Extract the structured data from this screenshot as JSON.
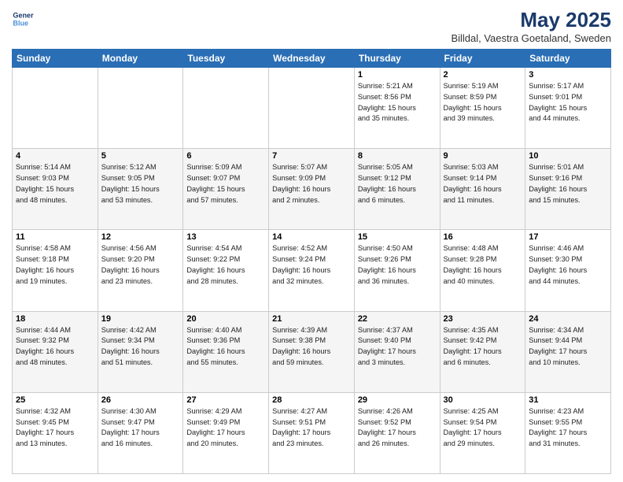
{
  "logo": {
    "line1": "General",
    "line2": "Blue"
  },
  "title": "May 2025",
  "subtitle": "Billdal, Vaestra Goetaland, Sweden",
  "days": [
    "Sunday",
    "Monday",
    "Tuesday",
    "Wednesday",
    "Thursday",
    "Friday",
    "Saturday"
  ],
  "weeks": [
    [
      {
        "day": "",
        "info": ""
      },
      {
        "day": "",
        "info": ""
      },
      {
        "day": "",
        "info": ""
      },
      {
        "day": "",
        "info": ""
      },
      {
        "day": "1",
        "info": "Sunrise: 5:21 AM\nSunset: 8:56 PM\nDaylight: 15 hours\nand 35 minutes."
      },
      {
        "day": "2",
        "info": "Sunrise: 5:19 AM\nSunset: 8:59 PM\nDaylight: 15 hours\nand 39 minutes."
      },
      {
        "day": "3",
        "info": "Sunrise: 5:17 AM\nSunset: 9:01 PM\nDaylight: 15 hours\nand 44 minutes."
      }
    ],
    [
      {
        "day": "4",
        "info": "Sunrise: 5:14 AM\nSunset: 9:03 PM\nDaylight: 15 hours\nand 48 minutes."
      },
      {
        "day": "5",
        "info": "Sunrise: 5:12 AM\nSunset: 9:05 PM\nDaylight: 15 hours\nand 53 minutes."
      },
      {
        "day": "6",
        "info": "Sunrise: 5:09 AM\nSunset: 9:07 PM\nDaylight: 15 hours\nand 57 minutes."
      },
      {
        "day": "7",
        "info": "Sunrise: 5:07 AM\nSunset: 9:09 PM\nDaylight: 16 hours\nand 2 minutes."
      },
      {
        "day": "8",
        "info": "Sunrise: 5:05 AM\nSunset: 9:12 PM\nDaylight: 16 hours\nand 6 minutes."
      },
      {
        "day": "9",
        "info": "Sunrise: 5:03 AM\nSunset: 9:14 PM\nDaylight: 16 hours\nand 11 minutes."
      },
      {
        "day": "10",
        "info": "Sunrise: 5:01 AM\nSunset: 9:16 PM\nDaylight: 16 hours\nand 15 minutes."
      }
    ],
    [
      {
        "day": "11",
        "info": "Sunrise: 4:58 AM\nSunset: 9:18 PM\nDaylight: 16 hours\nand 19 minutes."
      },
      {
        "day": "12",
        "info": "Sunrise: 4:56 AM\nSunset: 9:20 PM\nDaylight: 16 hours\nand 23 minutes."
      },
      {
        "day": "13",
        "info": "Sunrise: 4:54 AM\nSunset: 9:22 PM\nDaylight: 16 hours\nand 28 minutes."
      },
      {
        "day": "14",
        "info": "Sunrise: 4:52 AM\nSunset: 9:24 PM\nDaylight: 16 hours\nand 32 minutes."
      },
      {
        "day": "15",
        "info": "Sunrise: 4:50 AM\nSunset: 9:26 PM\nDaylight: 16 hours\nand 36 minutes."
      },
      {
        "day": "16",
        "info": "Sunrise: 4:48 AM\nSunset: 9:28 PM\nDaylight: 16 hours\nand 40 minutes."
      },
      {
        "day": "17",
        "info": "Sunrise: 4:46 AM\nSunset: 9:30 PM\nDaylight: 16 hours\nand 44 minutes."
      }
    ],
    [
      {
        "day": "18",
        "info": "Sunrise: 4:44 AM\nSunset: 9:32 PM\nDaylight: 16 hours\nand 48 minutes."
      },
      {
        "day": "19",
        "info": "Sunrise: 4:42 AM\nSunset: 9:34 PM\nDaylight: 16 hours\nand 51 minutes."
      },
      {
        "day": "20",
        "info": "Sunrise: 4:40 AM\nSunset: 9:36 PM\nDaylight: 16 hours\nand 55 minutes."
      },
      {
        "day": "21",
        "info": "Sunrise: 4:39 AM\nSunset: 9:38 PM\nDaylight: 16 hours\nand 59 minutes."
      },
      {
        "day": "22",
        "info": "Sunrise: 4:37 AM\nSunset: 9:40 PM\nDaylight: 17 hours\nand 3 minutes."
      },
      {
        "day": "23",
        "info": "Sunrise: 4:35 AM\nSunset: 9:42 PM\nDaylight: 17 hours\nand 6 minutes."
      },
      {
        "day": "24",
        "info": "Sunrise: 4:34 AM\nSunset: 9:44 PM\nDaylight: 17 hours\nand 10 minutes."
      }
    ],
    [
      {
        "day": "25",
        "info": "Sunrise: 4:32 AM\nSunset: 9:45 PM\nDaylight: 17 hours\nand 13 minutes."
      },
      {
        "day": "26",
        "info": "Sunrise: 4:30 AM\nSunset: 9:47 PM\nDaylight: 17 hours\nand 16 minutes."
      },
      {
        "day": "27",
        "info": "Sunrise: 4:29 AM\nSunset: 9:49 PM\nDaylight: 17 hours\nand 20 minutes."
      },
      {
        "day": "28",
        "info": "Sunrise: 4:27 AM\nSunset: 9:51 PM\nDaylight: 17 hours\nand 23 minutes."
      },
      {
        "day": "29",
        "info": "Sunrise: 4:26 AM\nSunset: 9:52 PM\nDaylight: 17 hours\nand 26 minutes."
      },
      {
        "day": "30",
        "info": "Sunrise: 4:25 AM\nSunset: 9:54 PM\nDaylight: 17 hours\nand 29 minutes."
      },
      {
        "day": "31",
        "info": "Sunrise: 4:23 AM\nSunset: 9:55 PM\nDaylight: 17 hours\nand 31 minutes."
      }
    ]
  ]
}
